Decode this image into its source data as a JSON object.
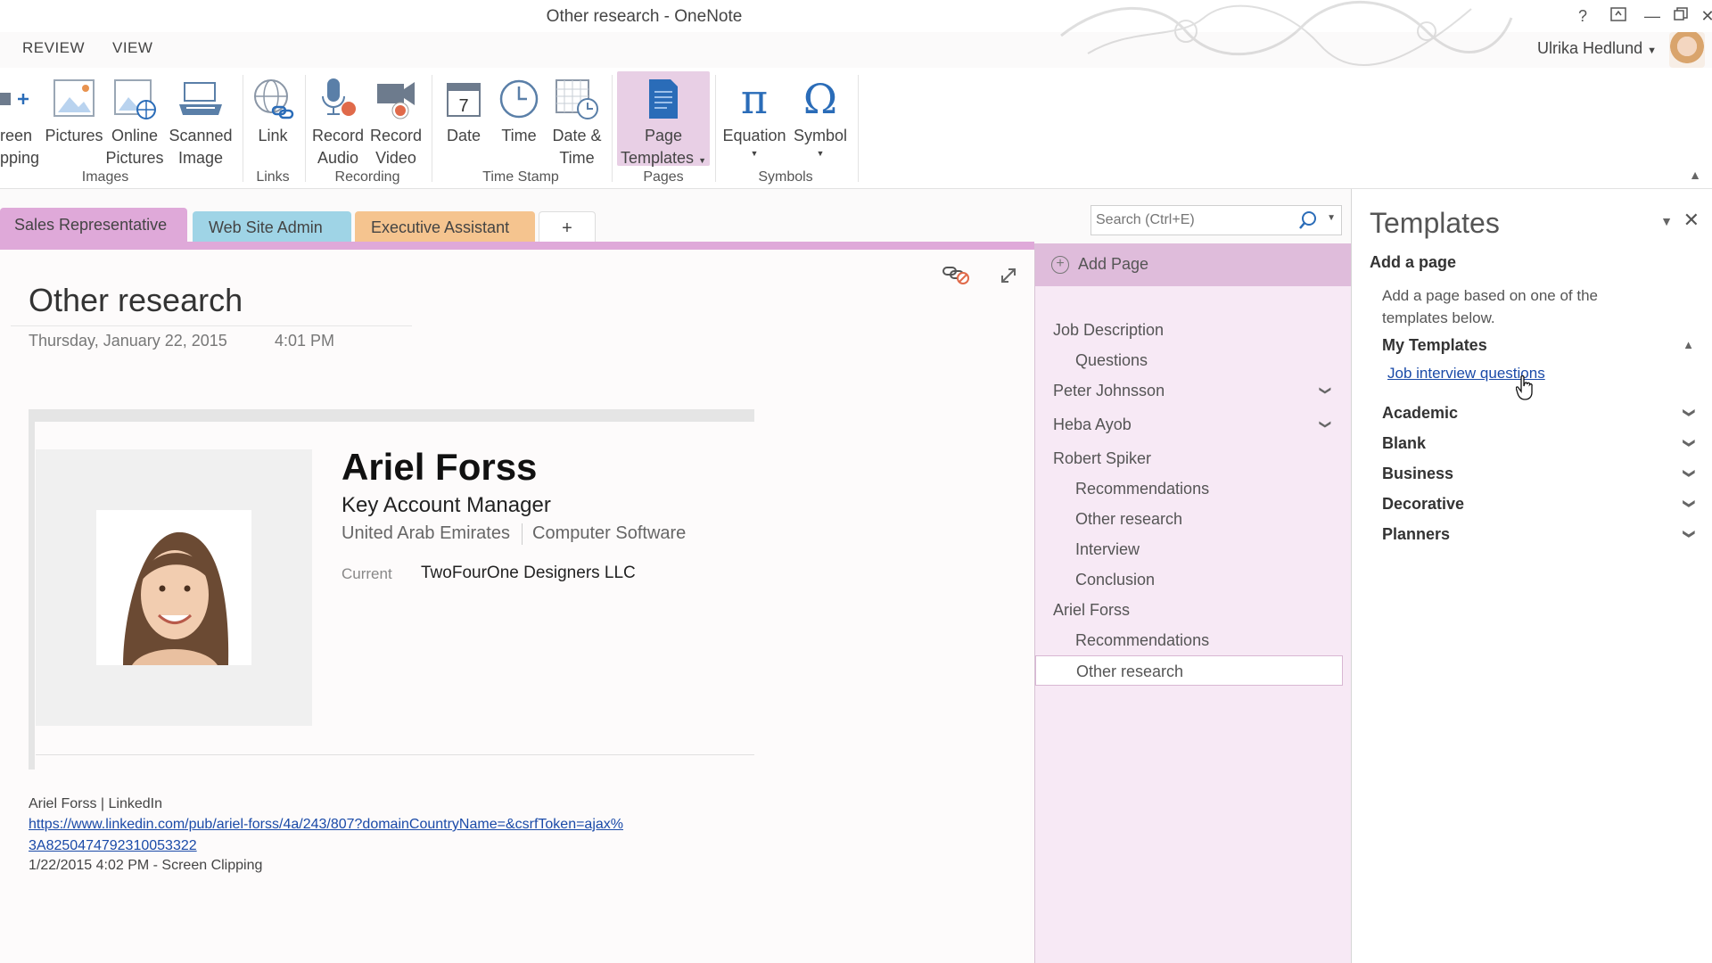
{
  "window": {
    "title": "Other research - OneNote",
    "controls": [
      "?",
      "restore-ribbon",
      "minimize",
      "maximize",
      "close"
    ]
  },
  "menu": {
    "tabs": [
      "REVIEW",
      "VIEW"
    ]
  },
  "user": {
    "name": "Ulrika Hedlund"
  },
  "ribbon": {
    "partial_left": [
      "reen",
      "pping"
    ],
    "buttons": {
      "pictures": "Pictures",
      "online_pictures": [
        "Online",
        "Pictures"
      ],
      "scanned_image": [
        "Scanned",
        "Image"
      ],
      "link": "Link",
      "record_audio": [
        "Record",
        "Audio"
      ],
      "record_video": [
        "Record",
        "Video"
      ],
      "date": "Date",
      "time": "Time",
      "date_time": [
        "Date &",
        "Time"
      ],
      "page_templates": [
        "Page",
        "Templates"
      ],
      "equation": "Equation",
      "symbol": "Symbol"
    },
    "groups": {
      "images": "Images",
      "links": "Links",
      "recording": "Recording",
      "time_stamp": "Time Stamp",
      "pages": "Pages",
      "symbols": "Symbols"
    },
    "date_icon_number": "7"
  },
  "sections": {
    "tabs": [
      {
        "label": "Sales Representative",
        "color": "#dfa9d9"
      },
      {
        "label": "Web Site Admin",
        "color": "#9fd4e6"
      },
      {
        "label": "Executive Assistant",
        "color": "#f5c48f"
      }
    ],
    "add_label": "+"
  },
  "search": {
    "placeholder": "Search (Ctrl+E)"
  },
  "page": {
    "title": "Other research",
    "date": "Thursday, January 22, 2015",
    "time": "4:01 PM",
    "profile": {
      "name": "Ariel Forss",
      "role": "Key Account Manager",
      "location": "United Arab Emirates",
      "industry": "Computer Software",
      "current_label": "Current",
      "current_value": "TwoFourOne Designers LLC"
    },
    "source": {
      "title": "Ariel Forss | LinkedIn",
      "url_line1": "https://www.linkedin.com/pub/ariel-forss/4a/243/807?domainCountryName=&csrfToken=ajax%",
      "url_line2": "3A8250474792310053322",
      "clip_info": "1/22/2015 4:02 PM - Screen Clipping"
    }
  },
  "pagelist": {
    "add_page": "Add Page",
    "items": [
      {
        "label": "Job Description",
        "level": 0
      },
      {
        "label": "Questions",
        "level": 1
      },
      {
        "label": "Peter Johnsson",
        "level": 0,
        "collapsible": true
      },
      {
        "label": "Heba Ayob",
        "level": 0,
        "collapsible": true
      },
      {
        "label": "Robert Spiker",
        "level": 0
      },
      {
        "label": "Recommendations",
        "level": 1
      },
      {
        "label": "Other research",
        "level": 1
      },
      {
        "label": "Interview",
        "level": 1
      },
      {
        "label": "Conclusion",
        "level": 1
      },
      {
        "label": "Ariel Forss",
        "level": 0
      },
      {
        "label": "Recommendations",
        "level": 1
      },
      {
        "label": "Other research",
        "level": 1,
        "selected": true
      }
    ]
  },
  "templates": {
    "title": "Templates",
    "subtitle": "Add a page",
    "description": "Add a page based on one of the templates below.",
    "categories": [
      "My Templates",
      "Academic",
      "Blank",
      "Business",
      "Decorative",
      "Planners"
    ],
    "my_templates_item": "Job interview questions"
  },
  "colors": {
    "accent": "#dfa9d9",
    "pagelist_bg": "#f7e9f5",
    "link": "#1a4aa8"
  }
}
